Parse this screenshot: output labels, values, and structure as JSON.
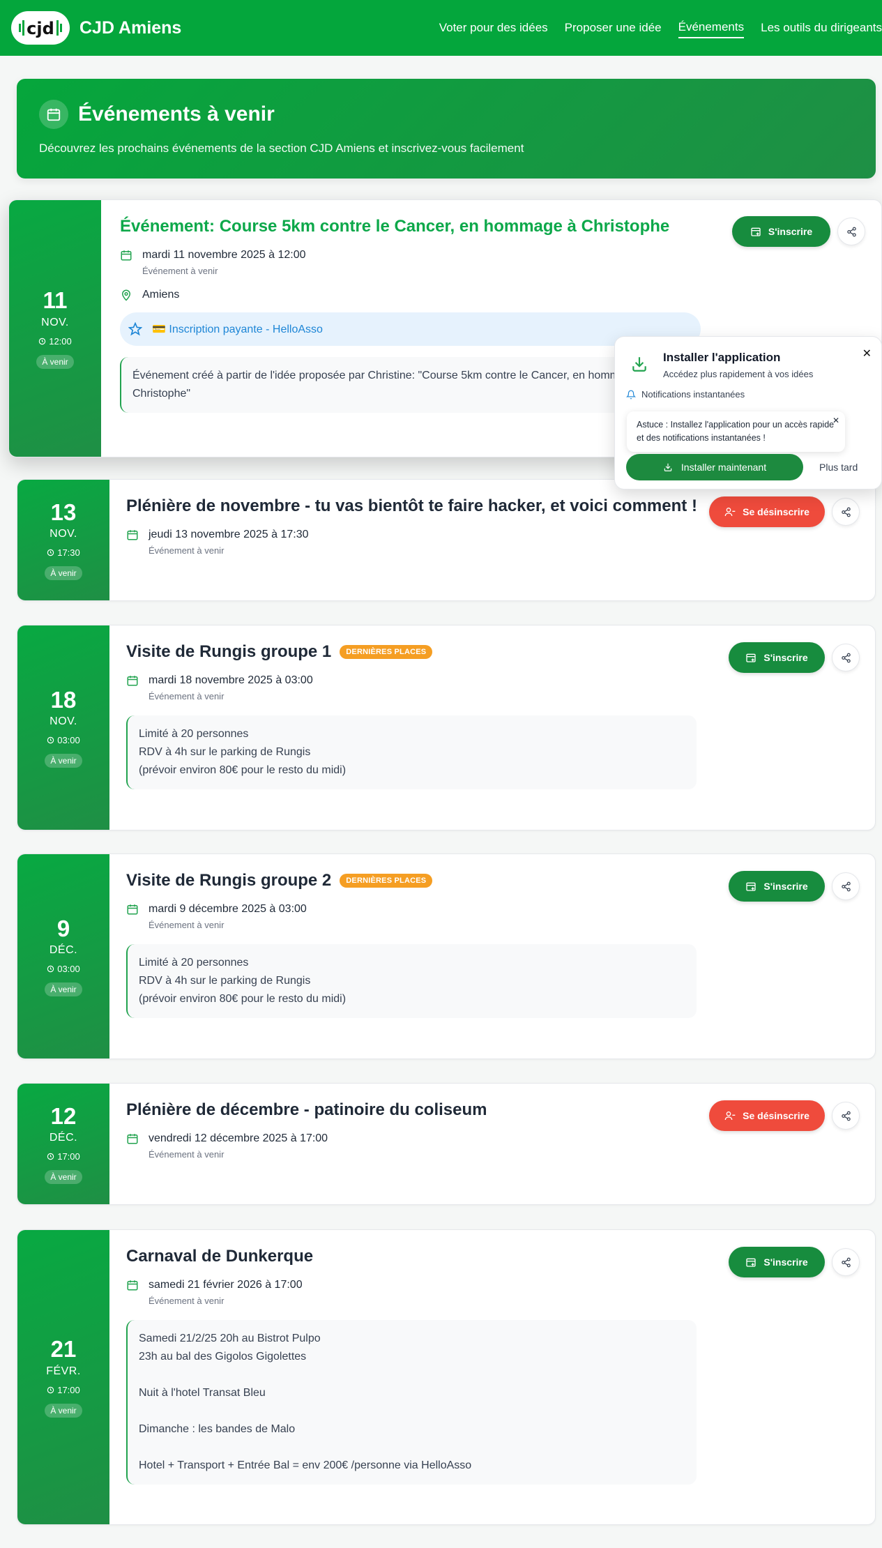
{
  "header": {
    "brand": "CJD Amiens",
    "logo_text": "cjd",
    "nav": [
      {
        "label": "Voter pour des idées",
        "active": false
      },
      {
        "label": "Proposer une idée",
        "active": false
      },
      {
        "label": "Événements",
        "active": true
      },
      {
        "label": "Les outils du dirigeants",
        "active": false
      }
    ]
  },
  "hero": {
    "title": "Événements à venir",
    "subtitle": "Découvrez les prochains événements de la section CJD Amiens et inscrivez-vous facilement"
  },
  "events": [
    {
      "day": "11",
      "month": "NOV.",
      "time": "12:00",
      "status": "À venir",
      "title": "Événement: Course 5km contre le Cancer, en hommage à Christophe",
      "date_text": "mardi 11 novembre 2025 à 12:00",
      "sub": "Événement à venir",
      "location": "Amiens",
      "payment": "💳 Inscription payante - HelloAsso",
      "description": "Événement créé à partir de l'idée proposée par Christine: \"Course 5km contre le Cancer, en hommage à Christophe\"",
      "action": "S'inscrire"
    },
    {
      "day": "13",
      "month": "NOV.",
      "time": "17:30",
      "status": "À venir",
      "title": "Plénière de novembre - tu vas bientôt te faire hacker, et voici comment !",
      "date_text": "jeudi 13 novembre 2025 à 17:30",
      "sub": "Événement à venir",
      "action": "Se désinscrire"
    },
    {
      "day": "18",
      "month": "NOV.",
      "time": "03:00",
      "status": "À venir",
      "title": "Visite de Rungis groupe 1",
      "tag": "DERNIÈRES PLACES",
      "date_text": "mardi 18 novembre 2025 à 03:00",
      "sub": "Événement à venir",
      "description": "Limité à 20 personnes\nRDV à 4h sur le parking de Rungis\n(prévoir environ 80€ pour le resto du midi)",
      "action": "S'inscrire"
    },
    {
      "day": "9",
      "month": "DÉC.",
      "time": "03:00",
      "status": "À venir",
      "title": "Visite de Rungis groupe 2",
      "tag": "DERNIÈRES PLACES",
      "date_text": "mardi 9 décembre 2025 à 03:00",
      "sub": "Événement à venir",
      "description": "Limité à 20 personnes\nRDV à 4h sur le parking de Rungis\n(prévoir environ 80€ pour le resto du midi)",
      "action": "S'inscrire"
    },
    {
      "day": "12",
      "month": "DÉC.",
      "time": "17:00",
      "status": "À venir",
      "title": "Plénière de décembre - patinoire du coliseum",
      "date_text": "vendredi 12 décembre 2025 à 17:00",
      "sub": "Événement à venir",
      "action": "Se désinscrire"
    },
    {
      "day": "21",
      "month": "FÉVR.",
      "time": "17:00",
      "status": "À venir",
      "title": "Carnaval de Dunkerque",
      "date_text": "samedi 21 février 2026 à 17:00",
      "sub": "Événement à venir",
      "description": "Samedi 21/2/25 20h au Bistrot Pulpo\n23h au bal des Gigolos Gigolettes\n\nNuit à l'hotel Transat Bleu\n\nDimanche : les bandes de Malo\n\nHotel + Transport + Entrée Bal = env 200€ /personne via HelloAsso",
      "action": "S'inscrire"
    }
  ],
  "install_popup": {
    "title": "Installer l'application",
    "subtitle": "Accédez plus rapidement à vos idées",
    "feature": "Notifications instantanées",
    "tip": "Astuce : Installez l'application pour un accès rapide et des notifications instantanées !",
    "install_button": "Installer maintenant",
    "later_button": "Plus tard"
  },
  "colors": {
    "primary": "#04a63c",
    "dark_green": "#178c3e",
    "danger": "#ef4b3c",
    "warning_tag": "#f59e23",
    "payment_blue": "#1e86d6"
  },
  "icons": [
    "calendar-icon",
    "map-pin-icon",
    "star-icon",
    "clock-icon",
    "share-icon",
    "calendar-plus-icon",
    "user-minus-icon",
    "download-icon",
    "bell-icon",
    "close-icon"
  ]
}
